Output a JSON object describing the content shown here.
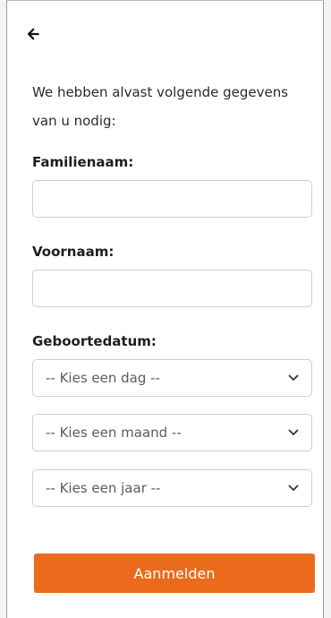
{
  "header": {
    "back_icon": "arrow-left-icon"
  },
  "intro": {
    "text": "We hebben alvast volgende gegevens van u nodig:"
  },
  "fields": {
    "familienaam": {
      "label": "Familienaam:",
      "value": ""
    },
    "voornaam": {
      "label": "Voornaam:",
      "value": ""
    },
    "geboortedatum": {
      "label": "Geboortedatum:",
      "day_selected": "-- Kies een dag --",
      "month_selected": "-- Kies een maand --",
      "year_selected": "-- Kies een jaar --"
    }
  },
  "actions": {
    "submit_label": "Aanmelden"
  },
  "colors": {
    "accent": "#ea6b1c",
    "background": "#ffffff",
    "border": "#cfcfcf"
  }
}
